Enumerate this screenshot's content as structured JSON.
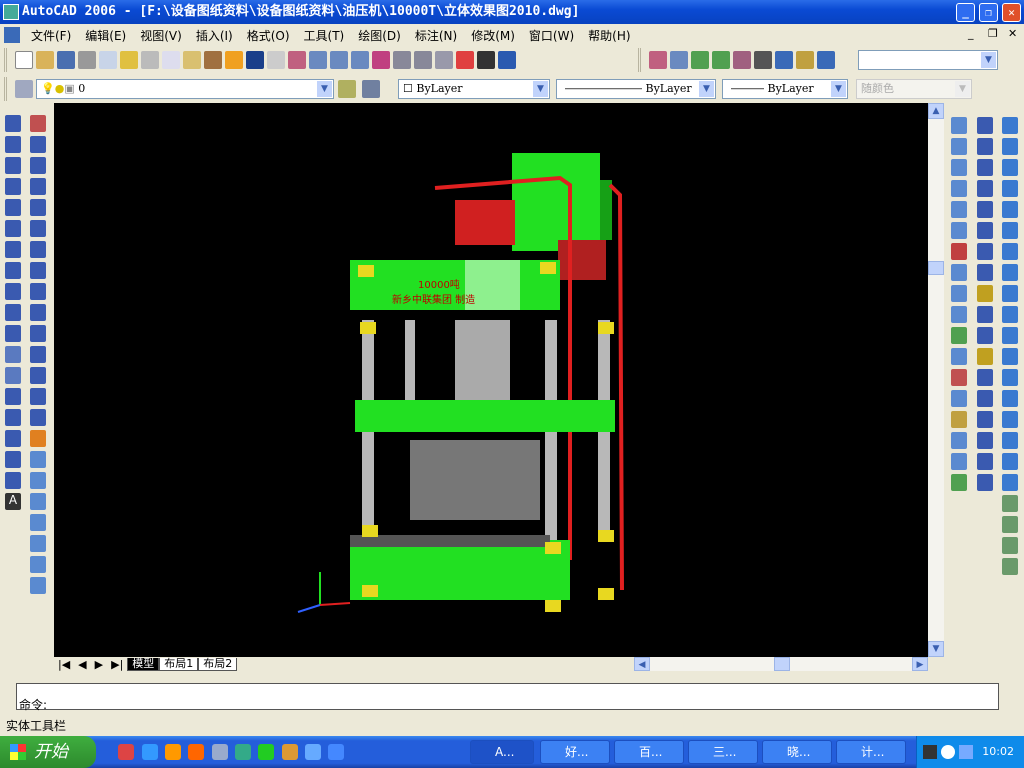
{
  "window": {
    "title": "AutoCAD 2006 - [F:\\设备图纸资料\\设备图纸资料\\油压机\\10000T\\立体效果图2010.dwg]",
    "min": "_",
    "restore": "❐",
    "close": "✕"
  },
  "doc_controls": {
    "min": "_",
    "restore": "❐",
    "close": "✕"
  },
  "menu": [
    "文件(F)",
    "编辑(E)",
    "视图(V)",
    "插入(I)",
    "格式(O)",
    "工具(T)",
    "绘图(D)",
    "标注(N)",
    "修改(M)",
    "窗口(W)",
    "帮助(H)"
  ],
  "layer": {
    "current": "0"
  },
  "properties": {
    "color": "ByLayer",
    "linetype": "ByLayer",
    "lineweight": "ByLayer",
    "plotstyle": "随颜色"
  },
  "drawing": {
    "label1": "10000吨",
    "label2": "新乡中联集团 制造"
  },
  "tabs": [
    "模型",
    "布局1",
    "布局2"
  ],
  "command": {
    "prompt": "命令:"
  },
  "status": {
    "text": "实体工具栏"
  },
  "taskbar": {
    "start": "开始",
    "tasks": [
      "A...",
      "好...",
      "百...",
      "三...",
      "晓...",
      "计..."
    ],
    "clock": "10:02"
  },
  "colors": {
    "title": "#0a4ad4",
    "canvas": "#000000",
    "press_green": "#22e022",
    "press_red": "#e02020"
  }
}
